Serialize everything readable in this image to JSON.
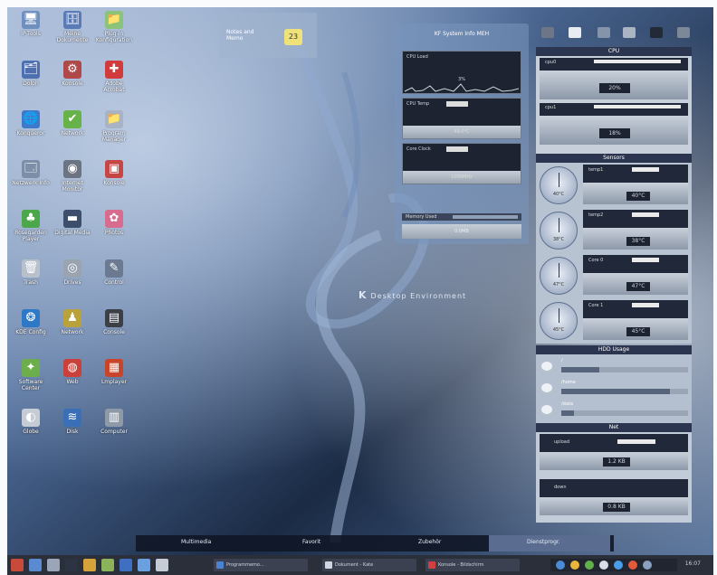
{
  "desktop": {
    "icons": [
      {
        "label": "IP-Tools",
        "color": "#6f8fbf",
        "glyph": "🖥"
      },
      {
        "label": "Meine Dokumente",
        "color": "#5a7bb5",
        "glyph": "🗄"
      },
      {
        "label": "Plug-In Konfiguration",
        "color": "#8bc37a",
        "glyph": "📁"
      },
      {
        "label": "Dolph",
        "color": "#4e6fb0",
        "glyph": "🗂"
      },
      {
        "label": "Konsole",
        "color": "#b04a4a",
        "glyph": "⚙"
      },
      {
        "label": "Adobe Acrobat",
        "color": "#d23b3b",
        "glyph": "✚"
      },
      {
        "label": "Konqueror",
        "color": "#3f79c9",
        "glyph": "🌐"
      },
      {
        "label": "Network",
        "color": "#67b34a",
        "glyph": "✔"
      },
      {
        "label": "Program Manager",
        "color": "#a9b3c6",
        "glyph": "📁"
      },
      {
        "label": "Netzwerk Info",
        "color": "#7d8fa8",
        "glyph": "🗔"
      },
      {
        "label": "Internet Monitor",
        "color": "#6b7480",
        "glyph": "◉"
      },
      {
        "label": "Konsole",
        "color": "#c64545",
        "glyph": "▣"
      },
      {
        "label": "Rosegarden Player",
        "color": "#4aa84a",
        "glyph": "♣"
      },
      {
        "label": "Digital Media",
        "color": "#3c4e6b",
        "glyph": "▬"
      },
      {
        "label": "Photos",
        "color": "#d86c8e",
        "glyph": "✿"
      },
      {
        "label": "Trash",
        "color": "#b8c0cc",
        "glyph": "🗑"
      },
      {
        "label": "Drives",
        "color": "#9aa4b0",
        "glyph": "◎"
      },
      {
        "label": "Control",
        "color": "#6b7a90",
        "glyph": "✎"
      },
      {
        "label": "KDE Config",
        "color": "#2e78c8",
        "glyph": "❂"
      },
      {
        "label": "Network",
        "color": "#b9a23c",
        "glyph": "♟"
      },
      {
        "label": "Console",
        "color": "#3b3f48",
        "glyph": "▤"
      },
      {
        "label": "Software Center",
        "color": "#6cae4c",
        "glyph": "✦"
      },
      {
        "label": "Web",
        "color": "#c9413a",
        "glyph": "◍"
      },
      {
        "label": "Lmplayer",
        "color": "#c8452a",
        "glyph": "▦"
      },
      {
        "label": "Globe",
        "color": "#c5ccd6",
        "glyph": "◐"
      },
      {
        "label": "Disk",
        "color": "#3a6fb8",
        "glyph": "≋"
      },
      {
        "label": "Computer",
        "color": "#8e9aa7",
        "glyph": "▥"
      }
    ],
    "kde_logo": "K",
    "kde_text": "Desktop Environment"
  },
  "notes_widget": {
    "line1": "Notes and",
    "line2": "Memo",
    "calendar": "23"
  },
  "system_monitor": {
    "title": "KF System Info MEH",
    "cpu_label": "CPU Load",
    "cpu_value": "3%",
    "temp_label": "CPU Temp",
    "temp_value": "49.0°C",
    "clock_label": "Core Clock",
    "clock_value": "1000MHz",
    "memory_label": "Memory Used",
    "swap_value": "0.0MB"
  },
  "right_monitor": {
    "cpu_header": "CPU",
    "cpu1_label": "cpu0",
    "cpu1_value": "20%",
    "cpu2_label": "cpu1",
    "cpu2_value": "18%",
    "sensors_header": "Sensors",
    "sensors": [
      {
        "label": "temp1",
        "value": "40°C",
        "gauge": "40°C"
      },
      {
        "label": "temp2",
        "value": "38°C",
        "gauge": "38°C"
      },
      {
        "label": "Core 0",
        "value": "47°C",
        "gauge": "47°C"
      },
      {
        "label": "Core 1",
        "value": "45°C",
        "gauge": "45°C"
      }
    ],
    "hdd_header": "HDD Usage",
    "hdds": [
      {
        "label": "/",
        "fill": 0.3
      },
      {
        "label": "/home",
        "fill": 0.86
      },
      {
        "label": "/data",
        "fill": 0.1
      }
    ],
    "net_header": "Net",
    "net_up_label": "upload",
    "net_up_value": "1.2 KB",
    "net_down_label": "down",
    "net_down_value": "0.8 KB"
  },
  "launcher": {
    "tabs": [
      "Multimedia",
      "Favorit",
      "Zubehör",
      "Dienstprogr."
    ]
  },
  "taskbar": {
    "tasks": [
      {
        "label": "Programmemo...",
        "color": "#4b83d2"
      },
      {
        "label": "Dokument - Kate",
        "color": "#cfd6e2"
      },
      {
        "label": "Konsole - Bildschirm",
        "color": "#d04040"
      }
    ],
    "clock": "16:07"
  }
}
